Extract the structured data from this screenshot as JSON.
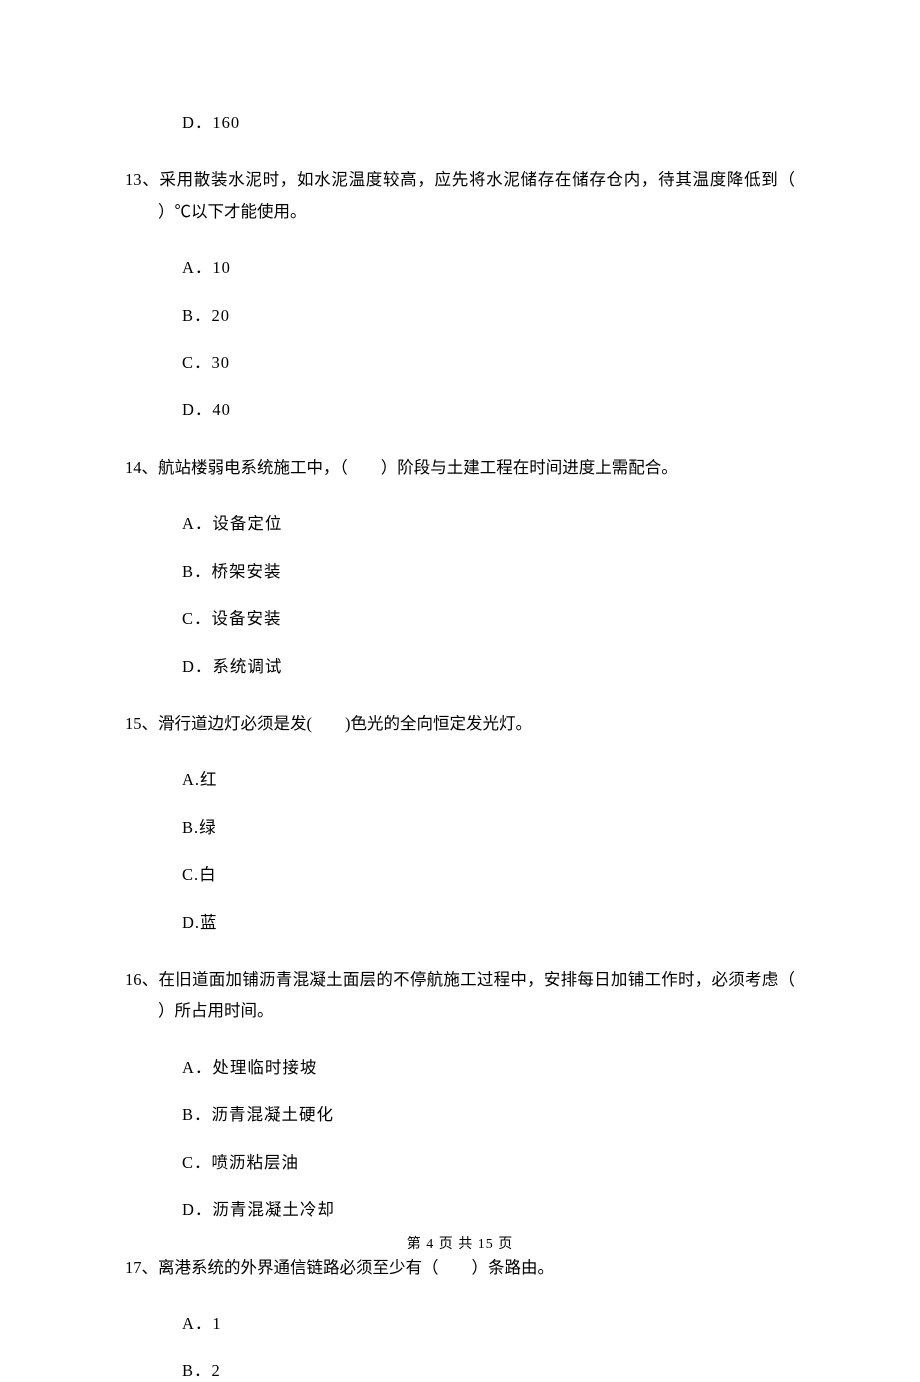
{
  "orphan_option": "D．160",
  "questions": [
    {
      "num": "13",
      "stem_prefix": "、采用散装水泥时，如水泥温度较高，应先将水泥储存在储存仓内，待其温度降低到（",
      "stem_blank": "　　",
      "stem_suffix": "）℃以下才能使用。",
      "options": [
        "A．10",
        "B．20",
        "C．30",
        "D．40"
      ]
    },
    {
      "num": "14",
      "stem_prefix": "、航站楼弱电系统施工中，（",
      "stem_blank": "　　",
      "stem_suffix": "）阶段与土建工程在时间进度上需配合。",
      "options": [
        "A．设备定位",
        "B．桥架安装",
        "C．设备安装",
        "D．系统调试"
      ]
    },
    {
      "num": "15",
      "stem_prefix": "、滑行道边灯必须是发(",
      "stem_blank": "　　",
      "stem_suffix": ")色光的全向恒定发光灯。",
      "options": [
        "A.红",
        "B.绿",
        "C.白",
        "D.蓝"
      ]
    },
    {
      "num": "16",
      "stem_prefix": "、在旧道面加铺沥青混凝土面层的不停航施工过程中，安排每日加铺工作时，必须考虑（",
      "stem_blank": "　　",
      "stem_suffix": "）所占用时间。",
      "options": [
        "A．处理临时接坡",
        "B．沥青混凝土硬化",
        "C．喷沥粘层油",
        "D．沥青混凝土冷却"
      ]
    },
    {
      "num": "17",
      "stem_prefix": "、离港系统的外界通信链路必须至少有（",
      "stem_blank": "　　",
      "stem_suffix": "）条路由。",
      "options": [
        "A．1",
        "B．2"
      ]
    }
  ],
  "footer": "第 4 页 共 15 页"
}
